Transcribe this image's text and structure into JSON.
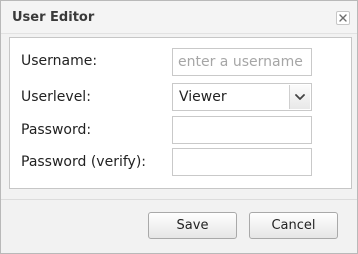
{
  "dialog": {
    "title": "User Editor",
    "close_icon": "close-icon"
  },
  "form": {
    "username": {
      "label": "Username:",
      "value": "",
      "placeholder": "enter a username"
    },
    "userlevel": {
      "label": "Userlevel:",
      "selected": "Viewer",
      "icon": "chevron-down-icon"
    },
    "password": {
      "label": "Password:",
      "value": ""
    },
    "password_verify": {
      "label": "Password (verify):",
      "value": ""
    }
  },
  "buttons": {
    "save": "Save",
    "cancel": "Cancel"
  }
}
